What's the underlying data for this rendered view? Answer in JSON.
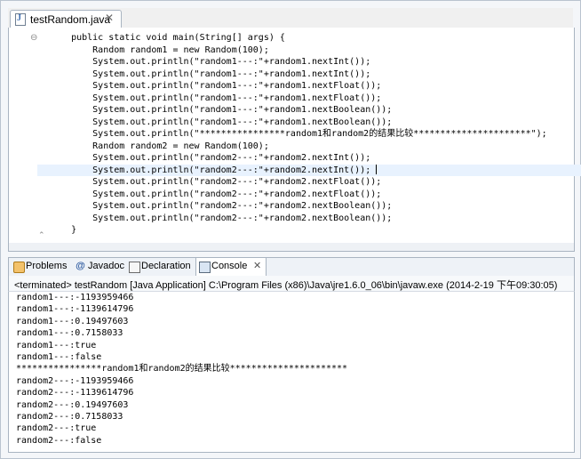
{
  "editor": {
    "tab_title": "testRandom.java",
    "tab_close": "✕",
    "code_lines": [
      "    public static void main(String[] args) {",
      "        Random random1 = new Random(100);",
      "        System.out.println(\"random1---:\"+random1.nextInt());",
      "        System.out.println(\"random1---:\"+random1.nextInt());",
      "        System.out.println(\"random1---:\"+random1.nextFloat());",
      "        System.out.println(\"random1---:\"+random1.nextFloat());",
      "        System.out.println(\"random1---:\"+random1.nextBoolean());",
      "        System.out.println(\"random1---:\"+random1.nextBoolean());",
      "        System.out.println(\"****************random1和random2的结果比较**********************\");",
      "        Random random2 = new Random(100);",
      "        System.out.println(\"random2---:\"+random2.nextInt());",
      "        System.out.println(\"random2---:\"+random2.nextInt());",
      "        System.out.println(\"random2---:\"+random2.nextFloat());",
      "        System.out.println(\"random2---:\"+random2.nextFloat());",
      "        System.out.println(\"random2---:\"+random2.nextBoolean());",
      "        System.out.println(\"random2---:\"+random2.nextBoolean());",
      "    }"
    ]
  },
  "views": {
    "problems": "Problems",
    "javadoc": "Javadoc",
    "declaration": "Declaration",
    "console": "Console",
    "console_close": "✕"
  },
  "console": {
    "header": "<terminated> testRandom [Java Application] C:\\Program Files (x86)\\Java\\jre1.6.0_06\\bin\\javaw.exe (2014-2-19 下午09:30:05)",
    "output_lines": [
      "random1---:-1193959466",
      "random1---:-1139614796",
      "random1---:0.19497603",
      "random1---:0.7158033",
      "random1---:true",
      "random1---:false",
      "****************random1和random2的结果比较**********************",
      "random2---:-1193959466",
      "random2---:-1139614796",
      "random2---:0.19497603",
      "random2---:0.7158033",
      "random2---:true",
      "random2---:false"
    ]
  }
}
